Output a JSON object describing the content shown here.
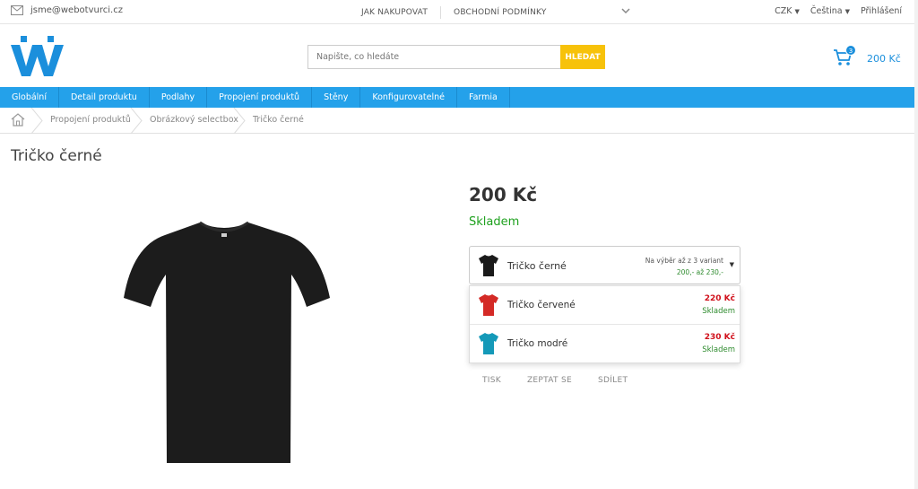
{
  "topbar": {
    "email": "jsme@webotvurci.cz",
    "nav": [
      "JAK NAKUPOVAT",
      "OBCHODNÍ PODMÍNKY"
    ],
    "currency": "CZK",
    "language": "Čeština",
    "login": "Přihlášení"
  },
  "header": {
    "search_placeholder": "Napište, co hledáte",
    "search_button": "HLEDAT",
    "cart_count": "3",
    "cart_total": "200 Kč"
  },
  "mainnav": [
    "Globální",
    "Detail produktu",
    "Podlahy",
    "Propojení produktů",
    "Stěny",
    "Konfigurovatelné",
    "Farmia"
  ],
  "breadcrumb": [
    "Propojení produktů",
    "Obrázkový selectbox",
    "Tričko černé"
  ],
  "product": {
    "title": "Tričko černé",
    "price": "200 Kč",
    "stock": "Skladem",
    "select": {
      "selected": "Tričko černé",
      "note_line1": "Na výběr až z 3 variant",
      "note_line2": "200,- až 230,-",
      "options": [
        {
          "label": "Tričko červené",
          "price": "220 Kč",
          "stock": "Skladem",
          "color": "#d42a26"
        },
        {
          "label": "Tričko modré",
          "price": "230 Kč",
          "stock": "Skladem",
          "color": "#1499b8"
        }
      ]
    },
    "actions": [
      "TISK",
      "ZEPTAT SE",
      "SDÍLET"
    ]
  },
  "colors": {
    "accent": "#24a1ea",
    "search_button": "#f7c20a",
    "in_stock": "#1fa11f",
    "price_red": "#d0101b"
  }
}
